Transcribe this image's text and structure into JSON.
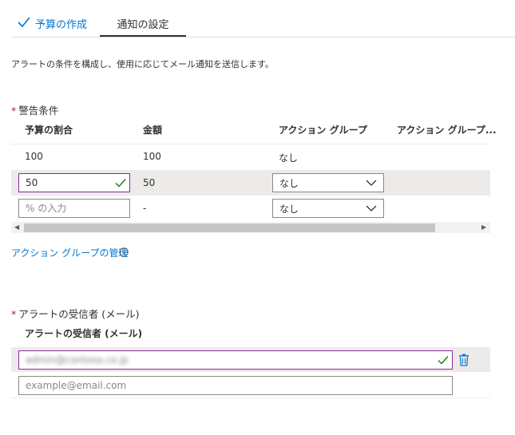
{
  "tabs": [
    {
      "label": "予算の作成",
      "state": "completed"
    },
    {
      "label": "通知の設定",
      "state": "active"
    }
  ],
  "description": "アラートの条件を構成し、使用に応じてメール通知を送信します。",
  "alert_conditions": {
    "label": "警告条件",
    "required_mark": "*",
    "columns": [
      "予算の割合",
      "金額",
      "アクション グループ",
      "アクション グループ..."
    ],
    "rows": [
      {
        "percent": "100",
        "amount": "100",
        "action_group": "なし"
      },
      {
        "percent": "50",
        "amount": "50",
        "action_group": "なし"
      },
      {
        "percent_placeholder": "% の入力",
        "amount": "-",
        "action_group": "なし"
      }
    ]
  },
  "manage_action_groups_link": "アクション グループの管理",
  "recipients": {
    "label": "アラートの受信者 (メール)",
    "required_mark": "*",
    "column_header": "アラートの受信者 (メール)",
    "email_blurred": "admin@contoso.co.jp",
    "email_placeholder": "example@email.com"
  },
  "icons": {
    "check": "checkmark-icon",
    "chevron": "chevron-down-icon",
    "info": "info-icon",
    "delete": "trash-icon"
  },
  "colors": {
    "accent": "#0078d4",
    "valid_border": "#8a2a9e",
    "check": "#107c10",
    "required": "#a4262c"
  }
}
